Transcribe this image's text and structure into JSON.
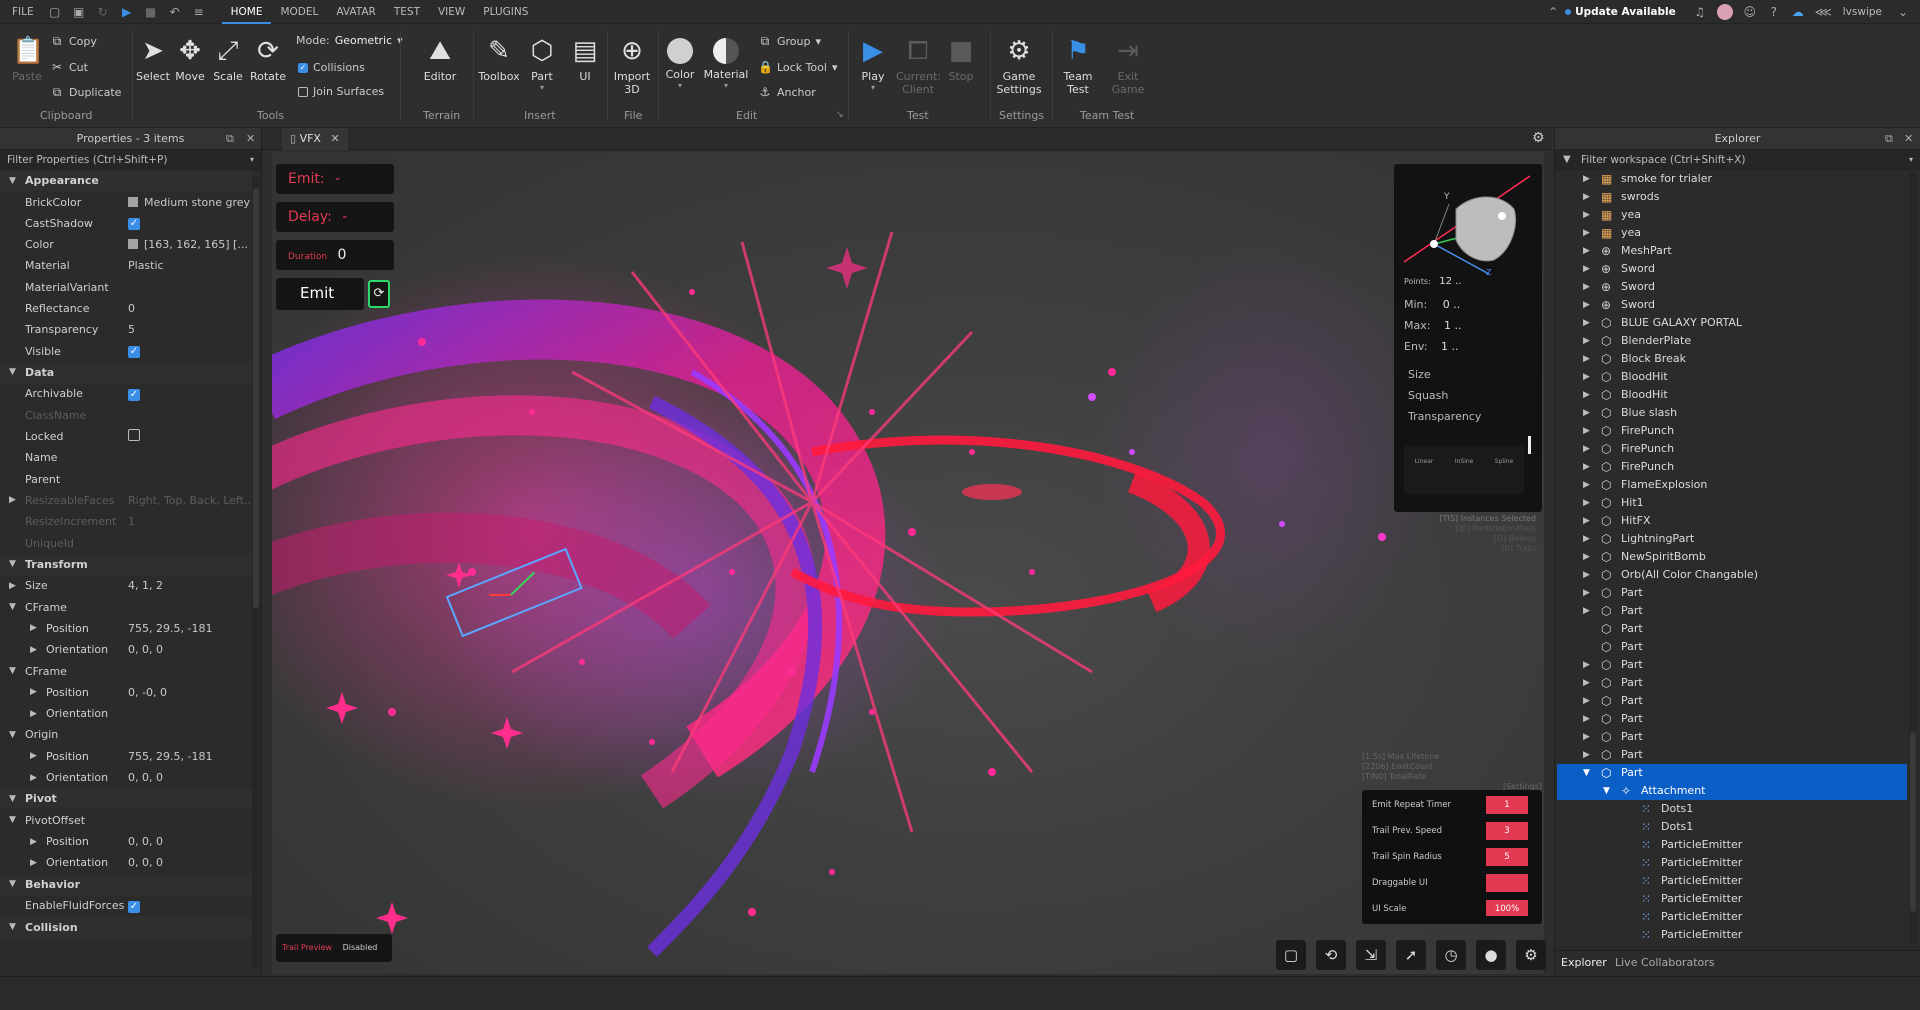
{
  "menubar": {
    "file": "FILE",
    "tabs": [
      "HOME",
      "MODEL",
      "AVATAR",
      "TEST",
      "VIEW",
      "PLUGINS"
    ],
    "update_label": "Update Available",
    "username": "lvswipe"
  },
  "ribbon": {
    "clipboard": {
      "paste": "Paste",
      "copy": "Copy",
      "cut": "Cut",
      "duplicate": "Duplicate",
      "label": "Clipboard"
    },
    "tools": {
      "select": "Select",
      "move": "Move",
      "scale": "Scale",
      "rotate": "Rotate",
      "mode_label": "Mode:",
      "mode_value": "Geometric",
      "collisions": "Collisions",
      "join_surfaces": "Join Surfaces",
      "label": "Tools"
    },
    "terrain": {
      "editor": "Editor",
      "label": "Terrain"
    },
    "insert": {
      "toolbox": "Toolbox",
      "part": "Part",
      "ui": "UI",
      "label": "Insert"
    },
    "file": {
      "import3d_line1": "Import",
      "import3d_line2": "3D",
      "label": "File"
    },
    "edit": {
      "color": "Color",
      "material": "Material",
      "group": "Group",
      "lock_tool": "Lock Tool",
      "anchor": "Anchor",
      "label": "Edit"
    },
    "test": {
      "play": "Play",
      "current_client_line1": "Current:",
      "current_client_line2": "Client",
      "stop": "Stop",
      "label": "Test"
    },
    "settings": {
      "game_settings_line1": "Game",
      "game_settings_line2": "Settings",
      "label": "Settings"
    },
    "team_test": {
      "team_test_line1": "Team",
      "team_test_line2": "Test",
      "exit_game_line1": "Exit",
      "exit_game_line2": "Game",
      "label": "Team Test"
    }
  },
  "properties": {
    "title": "Properties - 3 items",
    "filter": "Filter Properties (Ctrl+Shift+P)",
    "rows": [
      {
        "type": "section",
        "name": "Appearance"
      },
      {
        "name": "BrickColor",
        "value": "Medium stone grey",
        "swatch": "#a3a2a5"
      },
      {
        "name": "CastShadow",
        "check": true
      },
      {
        "name": "Color",
        "value": "[163, 162, 165] [...",
        "swatch": "#a3a2a5"
      },
      {
        "name": "Material",
        "value": "Plastic"
      },
      {
        "name": "MaterialVariant",
        "value": ""
      },
      {
        "name": "Reflectance",
        "value": "0"
      },
      {
        "name": "Transparency",
        "value": "5"
      },
      {
        "name": "Visible",
        "check": true
      },
      {
        "type": "section",
        "name": "Data"
      },
      {
        "name": "Archivable",
        "check": true
      },
      {
        "name": "ClassName",
        "value": "",
        "faded": true
      },
      {
        "name": "Locked",
        "check": false
      },
      {
        "name": "Name",
        "value": ""
      },
      {
        "name": "Parent",
        "value": ""
      },
      {
        "name": "ResizeableFaces",
        "value": "Right, Top, Back, Left...",
        "faded": true,
        "arrow": true
      },
      {
        "name": "ResizeIncrement",
        "value": "1",
        "faded": true
      },
      {
        "name": "UniqueId",
        "value": "",
        "faded": true
      },
      {
        "type": "section",
        "name": "Transform"
      },
      {
        "name": "Size",
        "value": "4, 1, 2",
        "arrow": true
      },
      {
        "name": "CFrame",
        "value": "",
        "arrow": true,
        "open": true
      },
      {
        "name": "Position",
        "value": "755, 29.5, -181",
        "indent": true,
        "arrow": true
      },
      {
        "name": "Orientation",
        "value": "0, 0, 0",
        "indent": true,
        "arrow": true
      },
      {
        "name": "CFrame",
        "value": "",
        "arrow": true,
        "open": true
      },
      {
        "name": "Position",
        "value": "0, -0, 0",
        "indent": true,
        "arrow": true
      },
      {
        "name": "Orientation",
        "value": "",
        "indent": true,
        "arrow": true
      },
      {
        "name": "Origin",
        "value": "",
        "arrow": true,
        "open": true
      },
      {
        "name": "Position",
        "value": "755, 29.5, -181",
        "indent": true,
        "arrow": true
      },
      {
        "name": "Orientation",
        "value": "0, 0, 0",
        "indent": true,
        "arrow": true
      },
      {
        "type": "section",
        "name": "Pivot"
      },
      {
        "name": "PivotOffset",
        "value": "",
        "arrow": true,
        "open": true
      },
      {
        "name": "Position",
        "value": "0, 0, 0",
        "indent": true,
        "arrow": true
      },
      {
        "name": "Orientation",
        "value": "0, 0, 0",
        "indent": true,
        "arrow": true
      },
      {
        "type": "section",
        "name": "Behavior"
      },
      {
        "name": "EnableFluidForces",
        "check": true
      },
      {
        "type": "section",
        "name": "Collision"
      }
    ]
  },
  "doc_tab": {
    "label": "VFX"
  },
  "vfx_panel": {
    "emit_label": "Emit:",
    "emit_value": "-",
    "delay_label": "Delay:",
    "delay_value": "-",
    "duration_label": "Duration",
    "duration_value": "0",
    "emit_button": "Emit",
    "trail_preview": "Trail Preview",
    "trail_state": "Disabled"
  },
  "gizmo": {
    "axis_y": "Y",
    "axis_z": "Z",
    "points_label": "Points:",
    "points_value": "12 ..",
    "min_label": "Min:",
    "min_value": "0 ..",
    "max_label": "Max:",
    "max_value": "1 ..",
    "env_label": "Env:",
    "env_value": "1 ..",
    "props": [
      "Size",
      "Squash",
      "Transparency"
    ],
    "easing": [
      "Linear",
      "InSine",
      "Spline"
    ],
    "footer": [
      "[TIS] Instances Selected",
      "[ID] ParticleEmitters",
      "[D] Beams",
      "[0] Trails"
    ]
  },
  "tweaks": {
    "header": [
      "[1.5s] Max Lifetime",
      "[2206] EmitCount",
      "[TIN0] TotalRate",
      "[Settings]"
    ],
    "rows": [
      {
        "label": "Emit Repeat Timer",
        "value": "1"
      },
      {
        "label": "Trail Prev. Speed",
        "value": "3"
      },
      {
        "label": "Trail Spin Radius",
        "value": "5"
      },
      {
        "label": "Draggable UI",
        "value": ""
      },
      {
        "label": "UI Scale",
        "value": "100%"
      }
    ]
  },
  "explorer": {
    "title": "Explorer",
    "filter": "Filter workspace (Ctrl+Shift+X)",
    "items": [
      {
        "label": "smoke for trialer",
        "icon": "model",
        "arrow": "right"
      },
      {
        "label": "swrods",
        "icon": "model",
        "arrow": "right"
      },
      {
        "label": "yea",
        "icon": "model",
        "arrow": "right"
      },
      {
        "label": "yea",
        "icon": "model",
        "arrow": "right"
      },
      {
        "label": "MeshPart",
        "icon": "mesh",
        "arrow": "right"
      },
      {
        "label": "Sword",
        "icon": "mesh",
        "arrow": "right"
      },
      {
        "label": "Sword",
        "icon": "mesh",
        "arrow": "right"
      },
      {
        "label": "Sword",
        "icon": "mesh",
        "arrow": "right"
      },
      {
        "label": "BLUE GALAXY PORTAL",
        "icon": "part",
        "arrow": "right"
      },
      {
        "label": "BlenderPlate",
        "icon": "part",
        "arrow": "right"
      },
      {
        "label": "Block Break",
        "icon": "part",
        "arrow": "right"
      },
      {
        "label": "BloodHit",
        "icon": "part",
        "arrow": "right"
      },
      {
        "label": "BloodHit",
        "icon": "part",
        "arrow": "right"
      },
      {
        "label": "Blue slash",
        "icon": "part",
        "arrow": "right"
      },
      {
        "label": "FirePunch",
        "icon": "part",
        "arrow": "right"
      },
      {
        "label": "FirePunch",
        "icon": "part",
        "arrow": "right"
      },
      {
        "label": "FirePunch",
        "icon": "part",
        "arrow": "right"
      },
      {
        "label": "FlameExplosion",
        "icon": "part",
        "arrow": "right"
      },
      {
        "label": "Hit1",
        "icon": "part",
        "arrow": "right"
      },
      {
        "label": "HitFX",
        "icon": "part",
        "arrow": "right"
      },
      {
        "label": "LightningPart",
        "icon": "part",
        "arrow": "right"
      },
      {
        "label": "NewSpiritBomb",
        "icon": "part",
        "arrow": "right"
      },
      {
        "label": "Orb(All Color Changable)",
        "icon": "part",
        "arrow": "right"
      },
      {
        "label": "Part",
        "icon": "part",
        "arrow": "right"
      },
      {
        "label": "Part",
        "icon": "part",
        "arrow": "right"
      },
      {
        "label": "Part",
        "icon": "part",
        "arrow": ""
      },
      {
        "label": "Part",
        "icon": "part",
        "arrow": ""
      },
      {
        "label": "Part",
        "icon": "part",
        "arrow": "right"
      },
      {
        "label": "Part",
        "icon": "part",
        "arrow": "right"
      },
      {
        "label": "Part",
        "icon": "part",
        "arrow": "right"
      },
      {
        "label": "Part",
        "icon": "part",
        "arrow": "right"
      },
      {
        "label": "Part",
        "icon": "part",
        "arrow": "right"
      },
      {
        "label": "Part",
        "icon": "part",
        "arrow": "right"
      },
      {
        "label": "Part",
        "icon": "part",
        "arrow": "down",
        "selected": true
      },
      {
        "label": "Attachment",
        "icon": "attachment",
        "arrow": "down",
        "selected": true,
        "level": 1
      },
      {
        "label": "Dots1",
        "icon": "emitter",
        "arrow": "",
        "level": 2
      },
      {
        "label": "Dots1",
        "icon": "emitter",
        "arrow": "",
        "level": 2
      },
      {
        "label": "ParticleEmitter",
        "icon": "emitter",
        "arrow": "",
        "level": 2
      },
      {
        "label": "ParticleEmitter",
        "icon": "emitter",
        "arrow": "",
        "level": 2
      },
      {
        "label": "ParticleEmitter",
        "icon": "emitter",
        "arrow": "",
        "level": 2
      },
      {
        "label": "ParticleEmitter",
        "icon": "emitter",
        "arrow": "",
        "level": 2
      },
      {
        "label": "ParticleEmitter",
        "icon": "emitter",
        "arrow": "",
        "level": 2
      },
      {
        "label": "ParticleEmitter",
        "icon": "emitter",
        "arrow": "",
        "level": 2
      }
    ],
    "bottom_tabs": [
      "Explorer",
      "Live Collaborators"
    ]
  },
  "colors": {
    "accent": "#3a8ee6",
    "selection": "#0b5ec5",
    "vfx_red": "#e23a52",
    "magenta": "#e0208f",
    "purple": "#7a2ee8"
  }
}
